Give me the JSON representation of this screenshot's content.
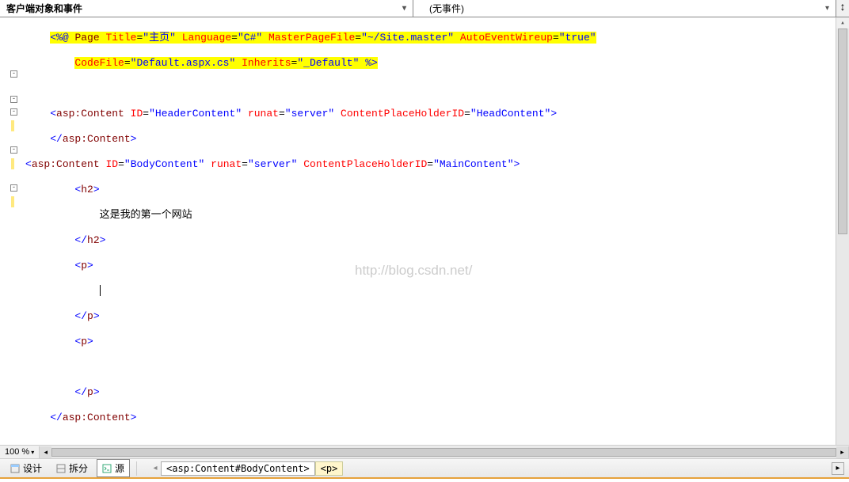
{
  "topbar": {
    "left_label": "客户端对象和事件",
    "right_label": "(无事件)"
  },
  "code": {
    "l1": "<%@ Page Title=\"主页\" Language=\"C#\" MasterPageFile=\"~/Site.master\" AutoEventWireup=\"true\"",
    "l2": "    CodeFile=\"Default.aspx.cs\" Inherits=\"_Default\" %>",
    "l4": "<asp:Content ID=\"HeaderContent\" runat=\"server\" ContentPlaceHolderID=\"HeadContent\">",
    "l5": "</asp:Content>",
    "l6a": "<asp:Content ID=\"BodyContent\" runat=\"server\" ContentPlaceHolderID=\"MainContent\">",
    "l7": "    <h2>",
    "l8": "        这是我的第一个网站",
    "l9": "    </h2>",
    "l10": "    <p>",
    "l12": "    </p>",
    "l13": "    <p>",
    "l15": "    </p>",
    "l16": "</asp:Content>",
    "page_title_val": "主页",
    "lang_val": "C#",
    "masterfile_val": "~/Site.master",
    "autowire_val": "true",
    "codefile_val": "Default.aspx.cs",
    "inherits_val": "_Default",
    "h2_text": "这是我的第一个网站",
    "header_id": "HeaderContent",
    "body_id": "BodyContent",
    "runat": "server",
    "cph_head": "HeadContent",
    "cph_main": "MainContent"
  },
  "watermark": "http://blog.csdn.net/",
  "zoom": "100 %",
  "bottom": {
    "design": "设计",
    "split": "拆分",
    "source": "源",
    "bc1": "<asp:Content#BodyContent>",
    "bc2": "<p>"
  }
}
